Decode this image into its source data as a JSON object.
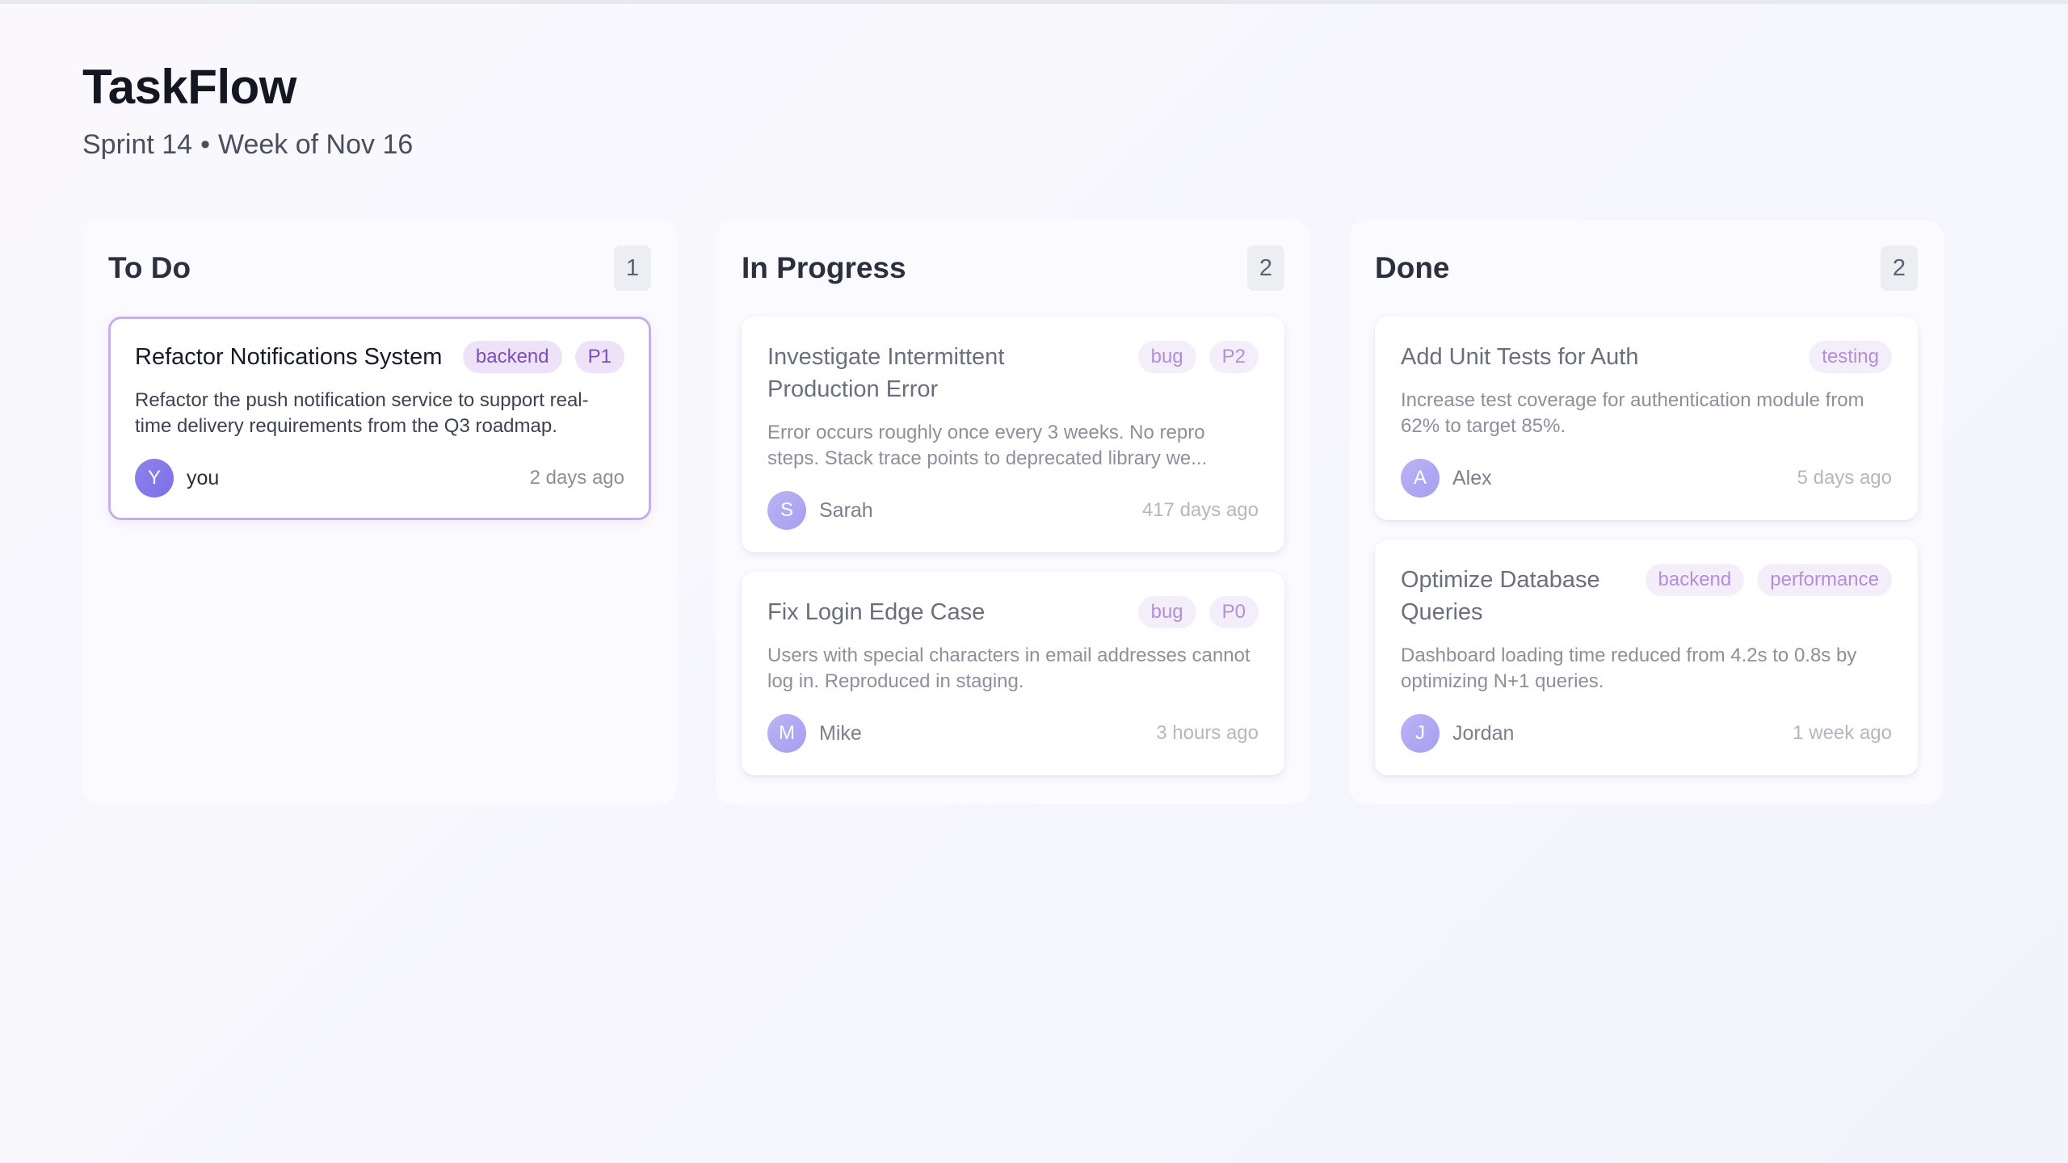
{
  "app": {
    "title": "TaskFlow",
    "sprint": "Sprint 14",
    "separator": "•",
    "week": "Week of Nov 16"
  },
  "columns": [
    {
      "title": "To Do",
      "count": "1",
      "cards": [
        {
          "title": "Refactor Notifications System",
          "tags": [
            "backend",
            "P1"
          ],
          "description": "Refactor the push notification service to support real-time delivery requirements from the Q3 roadmap.",
          "avatar": "Y",
          "assignee": "you",
          "time": "2 days ago"
        }
      ]
    },
    {
      "title": "In Progress",
      "count": "2",
      "cards": [
        {
          "title": "Investigate Intermittent Production Error",
          "tags": [
            "bug",
            "P2"
          ],
          "description": "Error occurs roughly once every 3 weeks. No repro steps. Stack trace points to deprecated library we...",
          "avatar": "S",
          "assignee": "Sarah",
          "time": "417 days ago"
        },
        {
          "title": "Fix Login Edge Case",
          "tags": [
            "bug",
            "P0"
          ],
          "description": "Users with special characters in email addresses cannot log in. Reproduced in staging.",
          "avatar": "M",
          "assignee": "Mike",
          "time": "3 hours ago"
        }
      ]
    },
    {
      "title": "Done",
      "count": "2",
      "cards": [
        {
          "title": "Add Unit Tests for Auth",
          "tags": [
            "testing"
          ],
          "description": "Increase test coverage for authentication module from 62% to target 85%.",
          "avatar": "A",
          "assignee": "Alex",
          "time": "5 days ago"
        },
        {
          "title": "Optimize Database Queries",
          "tags": [
            "backend",
            "performance"
          ],
          "description": "Dashboard loading time reduced from 4.2s to 0.8s by optimizing N+1 queries.",
          "avatar": "J",
          "assignee": "Jordan",
          "time": "1 week ago"
        }
      ]
    }
  ],
  "colors": {
    "tag_bg": "#f4eefb",
    "tag_text": "#b28fd6",
    "selected_border": "#c8aee8",
    "avatar": "#a89ef0"
  }
}
